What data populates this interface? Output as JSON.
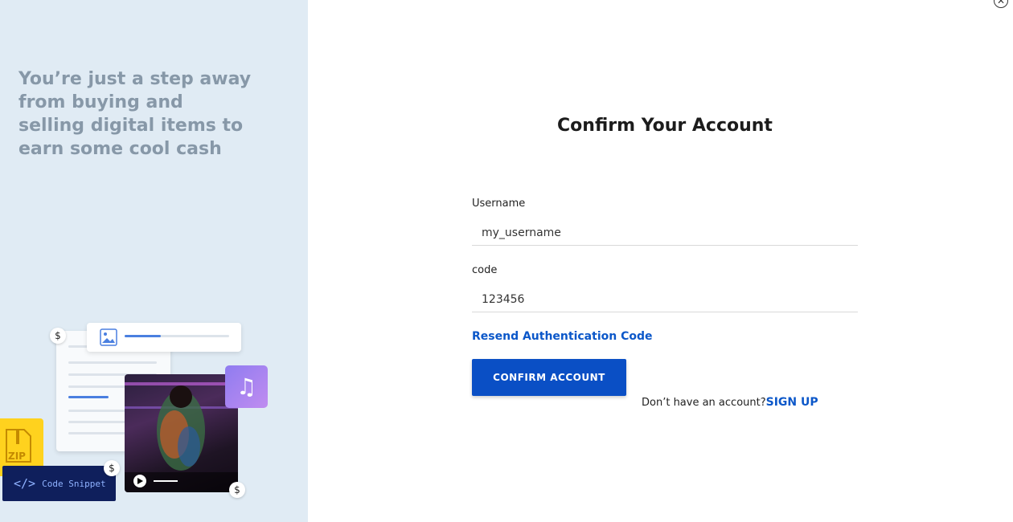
{
  "left_panel": {
    "tagline": "You’re just a step away from buying and selling digital items to earn some cool cash",
    "illustration": {
      "code_snippet_label": "Code Snippet",
      "code_tag": "</>",
      "zip_label": "ZIP",
      "dollar_symbol": "$"
    }
  },
  "dialog": {
    "title": "Confirm Your Account",
    "username": {
      "label": "Username",
      "value": "my_username"
    },
    "code": {
      "label": "code",
      "value": "123456"
    },
    "resend_link": "Resend Authentication Code",
    "confirm_button": "CONFIRM ACCOUNT",
    "signup_prompt": "Don’t have an account?",
    "signup_link": "SIGN UP",
    "close_icon": "close-icon"
  },
  "colors": {
    "accent": "#0a4fc5",
    "link": "#0b57c9",
    "left_bg": "#e0ebf4",
    "tagline": "#8798a8"
  }
}
